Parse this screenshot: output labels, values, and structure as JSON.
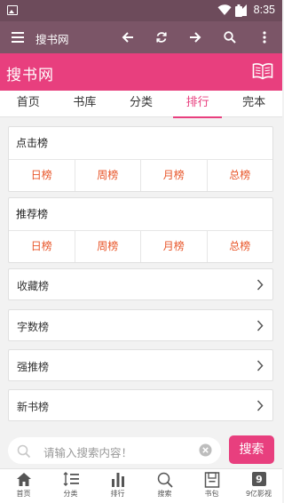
{
  "status_bar": {
    "time": "8:35"
  },
  "toolbar": {
    "title": "搜书网"
  },
  "app_header": {
    "title": "搜书网"
  },
  "nav_tabs": [
    {
      "label": "首页"
    },
    {
      "label": "书库"
    },
    {
      "label": "分类"
    },
    {
      "label": "排行",
      "active": true
    },
    {
      "label": "完本"
    }
  ],
  "rank_sections": [
    {
      "title": "点击榜",
      "periods": [
        "日榜",
        "周榜",
        "月榜",
        "总榜"
      ]
    },
    {
      "title": "推荐榜",
      "periods": [
        "日榜",
        "周榜",
        "月榜",
        "总榜"
      ]
    }
  ],
  "list_items": [
    {
      "label": "收藏榜"
    },
    {
      "label": "字数榜"
    },
    {
      "label": "强推榜"
    },
    {
      "label": "新书榜"
    }
  ],
  "search": {
    "placeholder": "请输入搜索内容！",
    "button_label": "搜索"
  },
  "bottom_nav": [
    {
      "label": "首页",
      "icon": "home-icon"
    },
    {
      "label": "分类",
      "icon": "list-icon"
    },
    {
      "label": "排行",
      "icon": "bar-chart-icon"
    },
    {
      "label": "搜索",
      "icon": "search-icon"
    },
    {
      "label": "书包",
      "icon": "bookbag-icon"
    },
    {
      "label": "9亿影视",
      "icon": "video-app-icon",
      "badge": "9"
    }
  ],
  "colors": {
    "accent": "#e83f7e",
    "rank_text": "#e8562a",
    "toolbar": "#7b5567",
    "status_bar": "#6d4b5b"
  }
}
